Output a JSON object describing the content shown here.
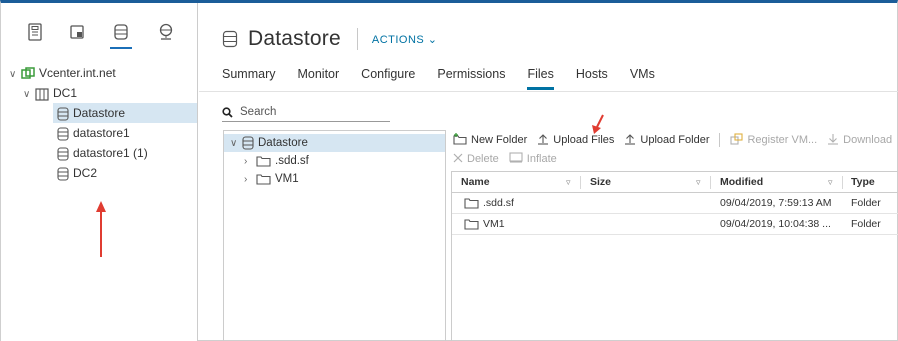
{
  "colors": {
    "accent": "#0072a3",
    "selection": "#d6e6f2",
    "datacenter_green": "#3a9c3a",
    "annotation_arrow": "#e03c31"
  },
  "left_panel": {
    "view_tabs": [
      {
        "name": "hosts-and-clusters-icon"
      },
      {
        "name": "vms-and-templates-icon"
      },
      {
        "name": "storage-icon",
        "active": true
      },
      {
        "name": "networking-icon"
      }
    ],
    "tree": {
      "vcenter": "Vcenter.int.net",
      "datacenter": "DC1",
      "items": [
        "Datastore",
        "datastore1",
        "datastore1 (1)",
        "DC2"
      ],
      "selected": "Datastore"
    }
  },
  "header": {
    "title": "Datastore",
    "actions_label": "ACTIONS ⌄"
  },
  "tabs": [
    "Summary",
    "Monitor",
    "Configure",
    "Permissions",
    "Files",
    "Hosts",
    "VMs"
  ],
  "active_tab": "Files",
  "search": {
    "placeholder": "Search"
  },
  "folder_tree": {
    "root": "Datastore",
    "children": [
      ".sdd.sf",
      "VM1"
    ]
  },
  "toolbar": {
    "new_folder": "New Folder",
    "upload_files": "Upload Files",
    "upload_folder": "Upload Folder",
    "register_vm": "Register VM...",
    "download": "Download",
    "delete": "Delete",
    "inflate": "Inflate"
  },
  "file_table": {
    "columns": [
      "Name",
      "Size",
      "Modified",
      "Type"
    ],
    "rows": [
      {
        "name": ".sdd.sf",
        "size": "",
        "modified": "09/04/2019, 7:59:13 AM",
        "type": "Folder"
      },
      {
        "name": "VM1",
        "size": "",
        "modified": "09/04/2019, 10:04:38 ...",
        "type": "Folder"
      }
    ]
  }
}
